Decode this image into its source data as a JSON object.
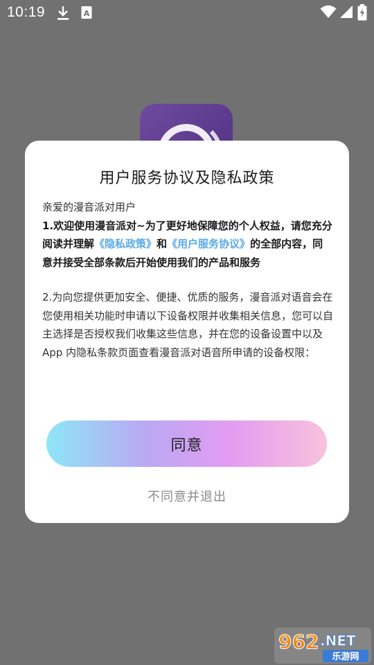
{
  "status_bar": {
    "time": "10:19",
    "left_icons": [
      "download-icon",
      "translate-icon"
    ],
    "right_icons": [
      "wifi-icon",
      "signal-icon",
      "battery-charging-icon"
    ]
  },
  "background_app": {
    "logo_icon": "app-logo-icon",
    "logo_color": "#5a3a8a"
  },
  "dialog": {
    "title": "用户服务协议及隐私政策",
    "greeting": "亲爱的漫音派对用户",
    "para1": {
      "before": "1.欢迎使用漫音派对~为了更好地保障您的个人权益，请您充分阅读并理解",
      "link1": "《隐私政策》",
      "middle": "和",
      "link2": "《用户服务协议》",
      "after": "的全部内容，同意并接受全部条款后开始使用我们的产品和服务"
    },
    "para2": "2.为向您提供更加安全、便捷、优质的服务，漫音派对语音会在您使用相关功能时申请以下设备权限并收集相关信息，您可以自主选择是否授权我们收集这些信息，并在您的设备设置中以及 App 内隐私条款页面查看漫音派对语音所申请的设备权限：",
    "agree_label": "同意",
    "disagree_label": "不同意并退出",
    "link_color": "#5aa9e6"
  },
  "watermark": {
    "number": "962",
    "suffix": ".NET",
    "subtitle": "乐游网"
  }
}
